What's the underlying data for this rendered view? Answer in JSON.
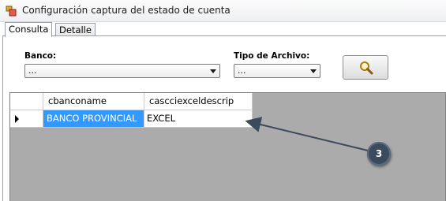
{
  "window": {
    "title": "Configuración captura del estado de cuenta"
  },
  "tabs": [
    {
      "label": "Consulta",
      "active": true
    },
    {
      "label": "Detalle",
      "active": false
    }
  ],
  "filters": {
    "banco": {
      "label": "Banco:",
      "value": "..."
    },
    "tipo_archivo": {
      "label": "Tipo de Archivo:",
      "value": "..."
    },
    "search_icon": "magnifier-icon"
  },
  "grid": {
    "columns": [
      "cbanconame",
      "cascciexceldescrip"
    ],
    "rows": [
      {
        "cbanconame": "BANCO PROVINCIAL",
        "cascciexceldescrip": "EXCEL",
        "selected": true
      }
    ]
  },
  "annotation": {
    "badge": "3"
  },
  "colors": {
    "selection": "#3399ff",
    "grid_background": "#ababab",
    "badge": "#3c4a5e"
  }
}
